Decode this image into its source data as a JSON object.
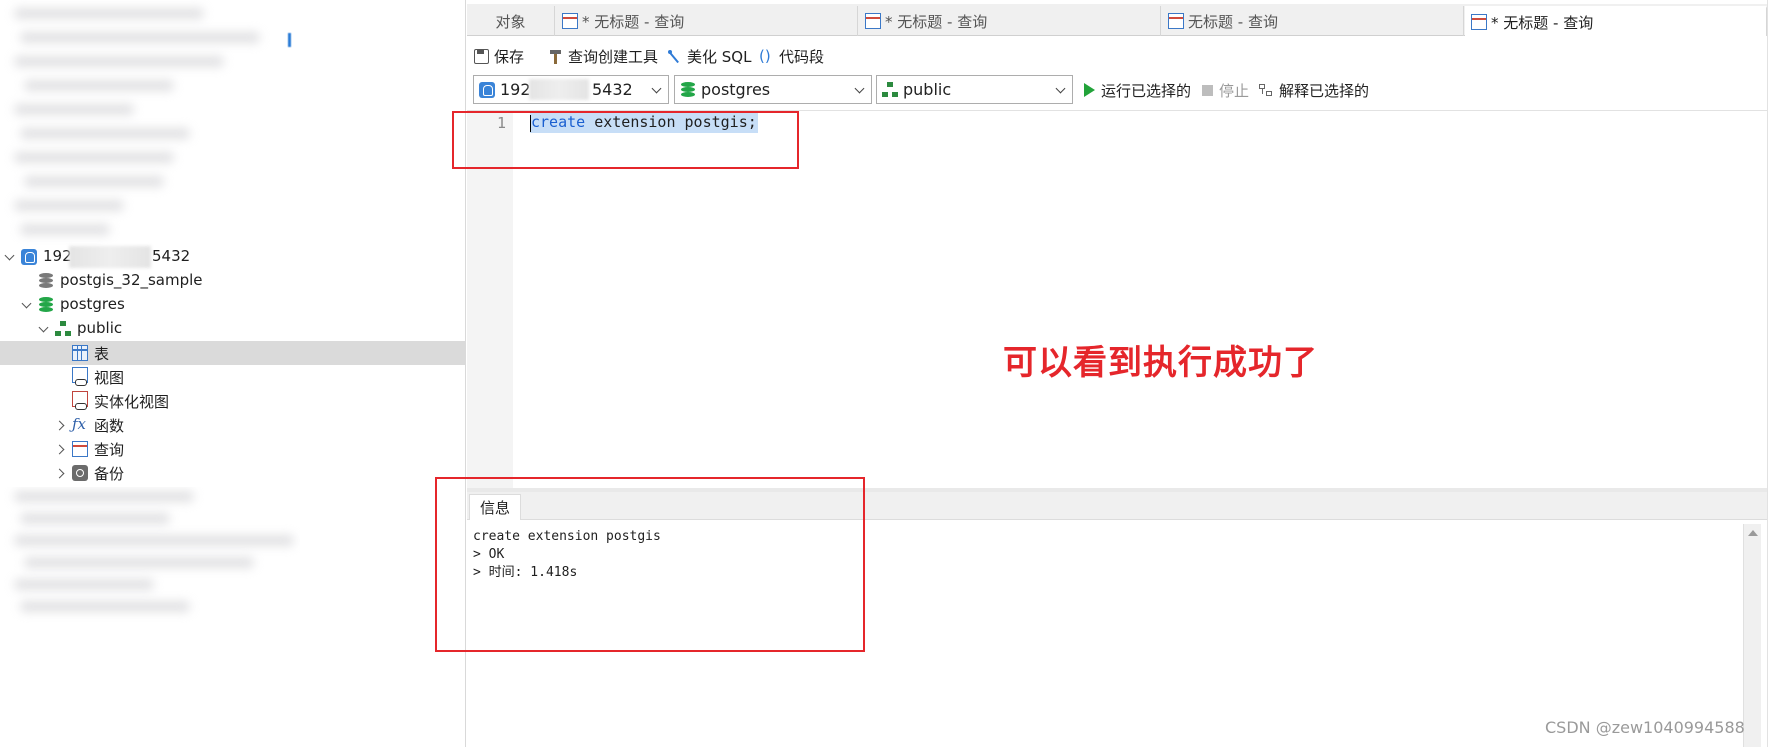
{
  "tree": {
    "server": {
      "ip_prefix": "192",
      "ip_suffix": "5432"
    },
    "items": [
      {
        "label": "postgis_32_sample"
      },
      {
        "label": "postgres"
      },
      {
        "label": "public"
      },
      {
        "label": "表"
      },
      {
        "label": "视图"
      },
      {
        "label": "实体化视图"
      },
      {
        "label": "函数"
      },
      {
        "label": "查询"
      },
      {
        "label": "备份"
      }
    ]
  },
  "tabs": [
    {
      "label": "对象"
    },
    {
      "label": "* 无标题 - 查询"
    },
    {
      "label": "* 无标题 - 查询"
    },
    {
      "label": "无标题 - 查询"
    },
    {
      "label": "* 无标题 - 查询",
      "active": true
    }
  ],
  "toolbar": {
    "save_label": "保存",
    "query_builder_label": "查询创建工具",
    "beautify_label": "美化 SQL",
    "snippet_label": "代码段"
  },
  "connection": {
    "server_prefix": "192",
    "server_suffix": "5432",
    "database": "postgres",
    "schema": "public",
    "run_selected_label": "运行已选择的",
    "stop_label": "停止",
    "explain_label": "解释已选择的"
  },
  "editor": {
    "line_number": "1",
    "keyword": "create",
    "rest": " extension postgis;"
  },
  "result": {
    "tab_label": "信息",
    "lines": [
      "create extension postgis",
      "> OK",
      "> 时间: 1.418s"
    ]
  },
  "annotation": {
    "text": "可以看到执行成功了",
    "color": "#e5262b"
  },
  "watermark": "CSDN @zew1040994588"
}
